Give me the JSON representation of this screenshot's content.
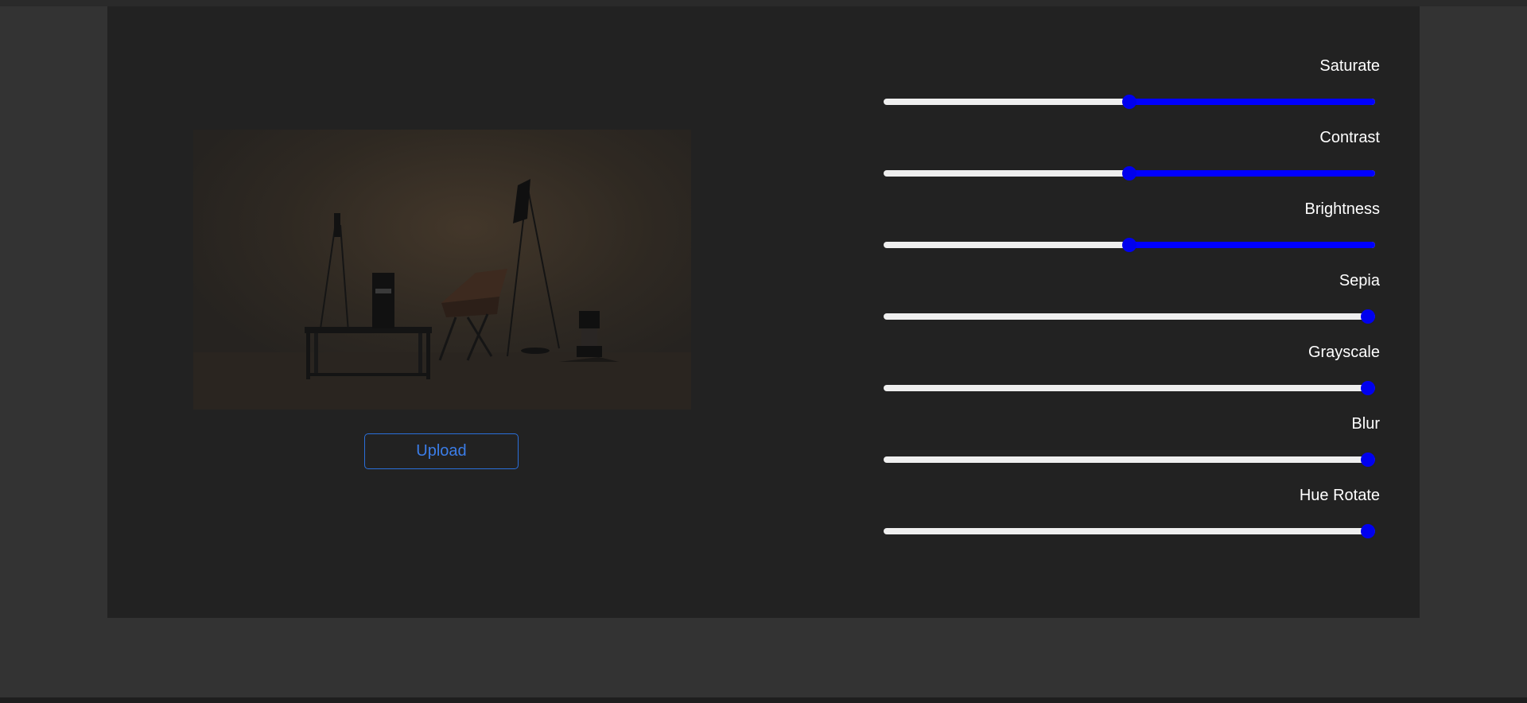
{
  "upload_label": "Upload",
  "accent_color": "#0000ff",
  "image": {
    "description_icon": "photo-lamps-chair"
  },
  "controls": [
    {
      "label": "Saturate",
      "value": 0.5,
      "filled": true
    },
    {
      "label": "Contrast",
      "value": 0.5,
      "filled": true
    },
    {
      "label": "Brightness",
      "value": 0.5,
      "filled": true
    },
    {
      "label": "Sepia",
      "value": 1.0,
      "filled": false
    },
    {
      "label": "Grayscale",
      "value": 1.0,
      "filled": false
    },
    {
      "label": "Blur",
      "value": 1.0,
      "filled": false
    },
    {
      "label": "Hue Rotate",
      "value": 1.0,
      "filled": false
    }
  ]
}
